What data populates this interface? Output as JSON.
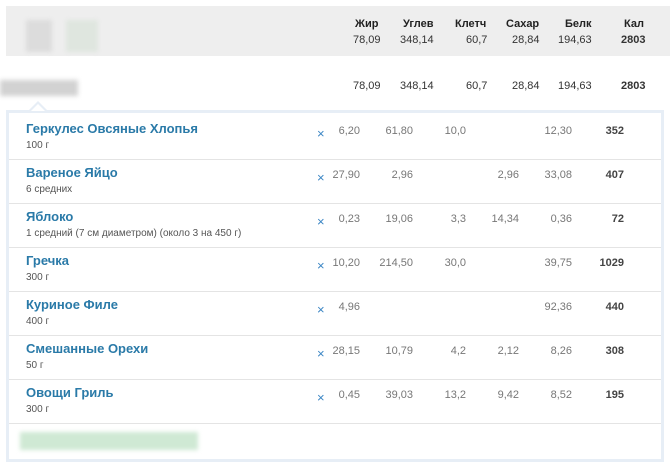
{
  "header": {
    "columns": [
      "Жир",
      "Углев",
      "Клетч",
      "Сахар",
      "Белк",
      "Кал"
    ],
    "totals": [
      "78,09",
      "348,14",
      "60,7",
      "28,84",
      "194,63",
      "2803"
    ]
  },
  "meal": {
    "totals": [
      "78,09",
      "348,14",
      "60,7",
      "28,84",
      "194,63",
      "2803"
    ]
  },
  "foods": [
    {
      "name": "Геркулес Овсяные Хлопья",
      "amount": "100 г",
      "fat": "6,20",
      "carbs": "61,80",
      "fiber": "10,0",
      "sugar": "",
      "protein": "12,30",
      "kcal": "352"
    },
    {
      "name": "Вареное Яйцо",
      "amount": "6 средних",
      "fat": "27,90",
      "carbs": "2,96",
      "fiber": "",
      "sugar": "2,96",
      "protein": "33,08",
      "kcal": "407"
    },
    {
      "name": "Яблоко",
      "amount": "1 средний (7 см диаметром) (около 3 на 450 г)",
      "fat": "0,23",
      "carbs": "19,06",
      "fiber": "3,3",
      "sugar": "14,34",
      "protein": "0,36",
      "kcal": "72"
    },
    {
      "name": "Гречка",
      "amount": "300 г",
      "fat": "10,20",
      "carbs": "214,50",
      "fiber": "30,0",
      "sugar": "",
      "protein": "39,75",
      "kcal": "1029"
    },
    {
      "name": "Куриное Филе",
      "amount": "400 г",
      "fat": "4,96",
      "carbs": "",
      "fiber": "",
      "sugar": "",
      "protein": "92,36",
      "kcal": "440"
    },
    {
      "name": "Смешанные Орехи",
      "amount": "50 г",
      "fat": "28,15",
      "carbs": "10,79",
      "fiber": "4,2",
      "sugar": "2,12",
      "protein": "8,26",
      "kcal": "308"
    },
    {
      "name": "Овощи Гриль",
      "amount": "300 г",
      "fat": "0,45",
      "carbs": "39,03",
      "fiber": "13,2",
      "sugar": "9,42",
      "protein": "8,52",
      "kcal": "195"
    }
  ],
  "icons": {
    "delete": "close-icon"
  },
  "colors": {
    "link": "#2a7aa8",
    "delete": "#3b86c4",
    "header_bg": "#eeeeee",
    "panel_border": "#e7eef6"
  }
}
